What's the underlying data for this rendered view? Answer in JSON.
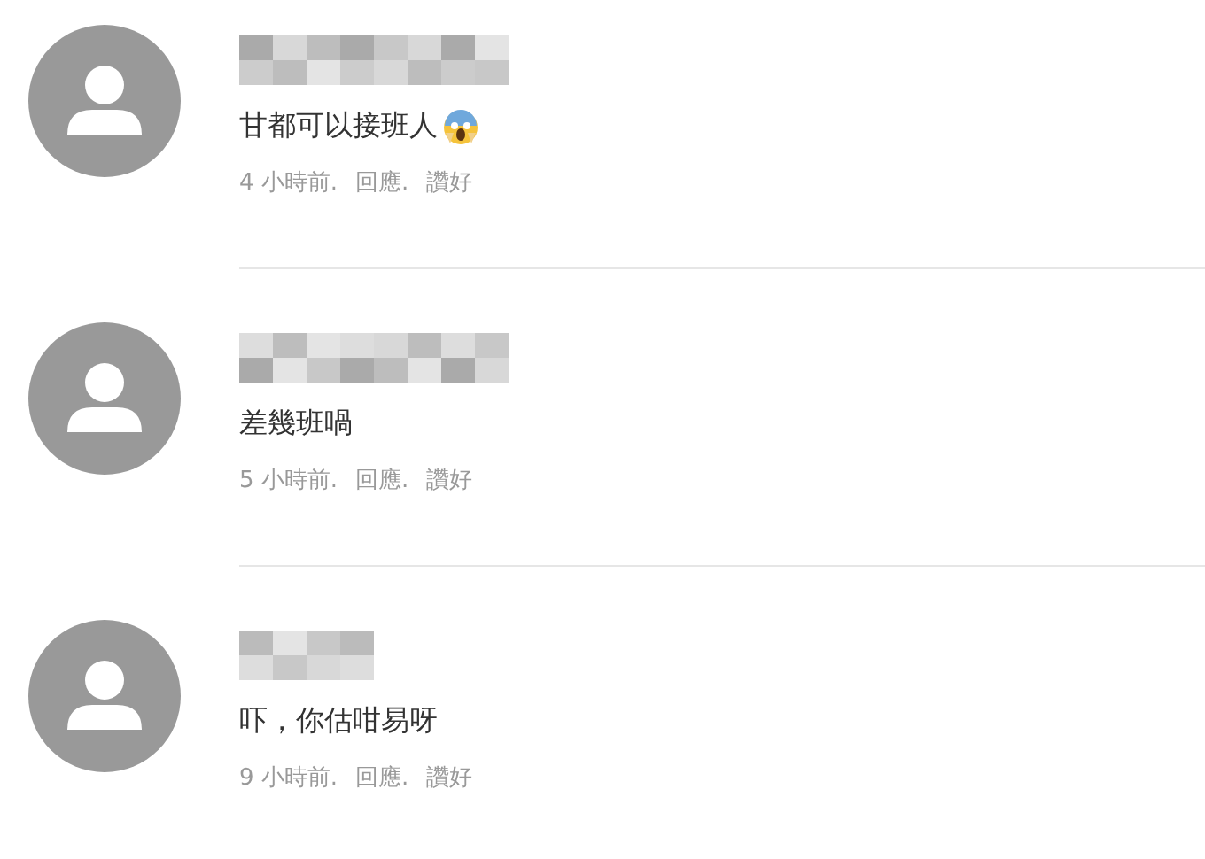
{
  "comments": [
    {
      "text": "甘都可以接班人",
      "shocked_icon": true,
      "time": "4 小時前.",
      "reply": "回應.",
      "like": "讚好"
    },
    {
      "text": "差幾班喎",
      "shocked_icon": false,
      "time": "5 小時前.",
      "reply": "回應.",
      "like": "讚好"
    },
    {
      "text": "吓，你估咁易呀",
      "shocked_icon": false,
      "time": "9 小時前.",
      "reply": "回應.",
      "like": "讚好"
    }
  ]
}
